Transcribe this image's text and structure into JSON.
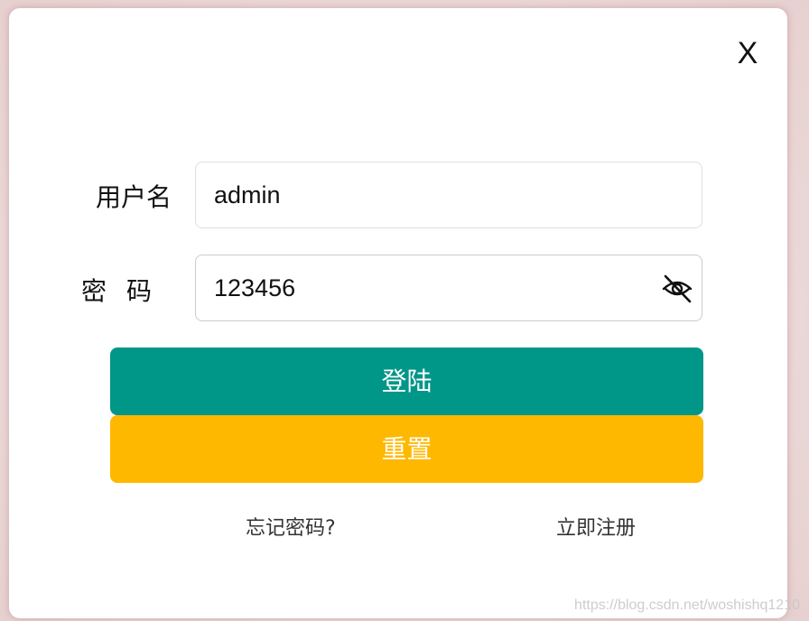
{
  "dialog": {
    "close_label": "X",
    "username": {
      "label": "用户名",
      "value": "admin"
    },
    "password": {
      "label": "密码",
      "value": "123456",
      "toggle_icon": "eye-off-icon"
    },
    "login_button": "登陆",
    "reset_button": "重置",
    "forgot_link": "忘记密码?",
    "register_link": "立即注册"
  },
  "watermark": "https://blog.csdn.net/woshishq1210",
  "colors": {
    "login": "#009688",
    "reset": "#ffb800"
  }
}
